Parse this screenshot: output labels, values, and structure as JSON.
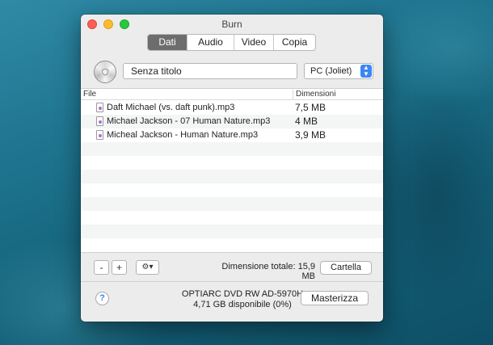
{
  "window": {
    "title": "Burn"
  },
  "tabs": [
    {
      "label": "Dati",
      "active": true
    },
    {
      "label": "Audio",
      "active": false
    },
    {
      "label": "Video",
      "active": false
    },
    {
      "label": "Copia",
      "active": false
    }
  ],
  "disc": {
    "icon": "cd-icon",
    "name_value": "Senza titolo",
    "format_selected": "PC (Joliet)"
  },
  "table": {
    "columns": [
      "File",
      "Dimensioni"
    ],
    "rows": [
      {
        "name": "Daft Michael (vs. daft punk).mp3",
        "size": "7,5 MB"
      },
      {
        "name": "Michael Jackson - 07 Human Nature.mp3",
        "size": "4 MB"
      },
      {
        "name": "Micheal Jackson - Human Nature.mp3",
        "size": "3,9 MB"
      }
    ]
  },
  "toolbar": {
    "remove_label": "-",
    "add_label": "+",
    "action_label": "⚙▾",
    "total_label": "Dimensione totale: 15,9 MB",
    "folder_label": "Cartella"
  },
  "footer": {
    "help_label": "?",
    "drive_name": "OPTIARC DVD RW AD-5970H",
    "drive_space": "4,71 GB disponibile (0%)",
    "burn_label": "Masterizza"
  }
}
